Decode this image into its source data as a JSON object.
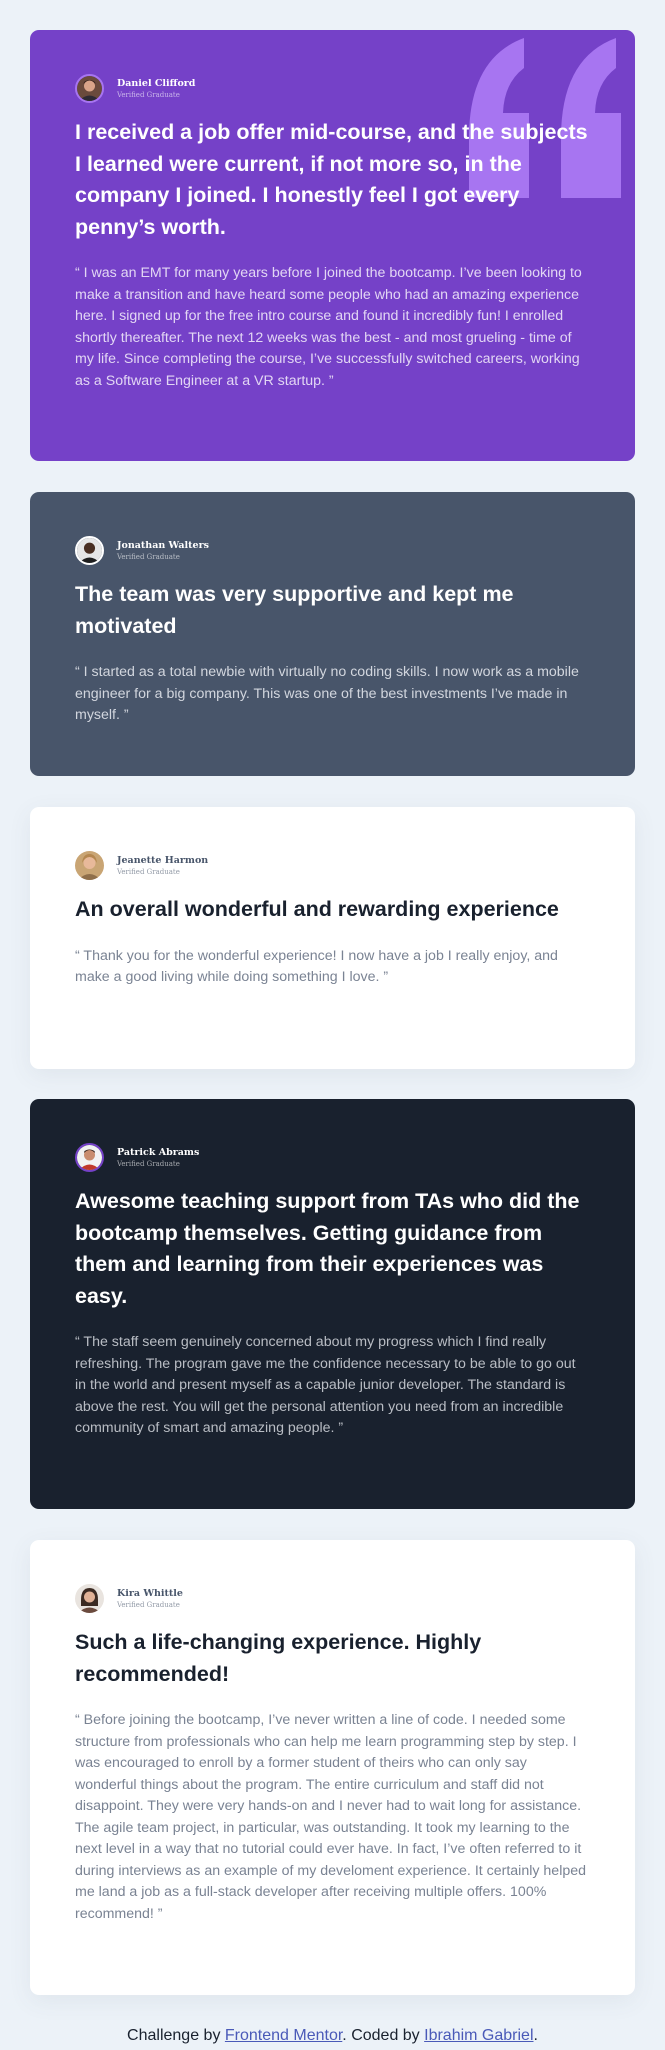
{
  "testimonials": [
    {
      "name": "Daniel Clifford",
      "role": "Verified Graduate",
      "headline": "I received a job offer mid-course, and the subjects I learned were current, if not more so, in the company I joined. I honestly feel I got every penny’s worth.",
      "body": "“ I was an EMT for many years before I joined the bootcamp. I’ve been looking to make a transition and have heard some people who had an amazing experience here. I signed up for the free intro course and found it incredibly fun! I enrolled shortly thereafter. The next 12 weeks was the best - and most grueling - time of my life. Since completing the course, I’ve successfully switched careers, working as a Software Engineer at a VR startup. ”"
    },
    {
      "name": "Jonathan Walters",
      "role": "Verified Graduate",
      "headline": "The team was very supportive and kept me motivated",
      "body": "“ I started as a total newbie with virtually no coding skills. I now work as a mobile engineer for a big company. This was one of the best investments I’ve made in myself. ”"
    },
    {
      "name": "Jeanette Harmon",
      "role": "Verified Graduate",
      "headline": "An overall wonderful and rewarding experience",
      "body": "“ Thank you for the wonderful experience! I now have a job I really enjoy, and make a good living while doing something I love. ”"
    },
    {
      "name": "Patrick Abrams",
      "role": "Verified Graduate",
      "headline": "Awesome teaching support from TAs who did the bootcamp themselves. Getting guidance from them and learning from their experiences was easy.",
      "body": "“ The staff seem genuinely concerned about my progress which I find really refreshing. The program gave me the confidence necessary to be able to go out in the world and present myself as a capable junior developer. The standard is above the rest. You will get the personal attention you need from an incredible community of smart and amazing people. ”"
    },
    {
      "name": "Kira Whittle",
      "role": "Verified Graduate",
      "headline": "Such a life-changing experience. Highly recommended!",
      "body": "“ Before joining the bootcamp, I’ve never written a line of code. I needed some structure from professionals who can help me learn programming step by step. I was encouraged to enroll by a former student of theirs who can only say wonderful things about the program. The entire curriculum and staff did not disappoint. They were very hands-on and I never had to wait long for assistance. The agile team project, in particular, was outstanding. It took my learning to the next level in a way that no tutorial could ever have. In fact, I’ve often referred to it during interviews as an example of my develoment experience. It certainly helped me land a job as a full-stack developer after receiving multiple offers. 100% recommend! ”"
    }
  ],
  "footer": {
    "prefix": "Challenge by ",
    "link1": "Frontend Mentor",
    "middle": ". Coded by ",
    "link2": "Ibrahim Gabriel",
    "suffix": "."
  },
  "colors": {
    "purple": "#7541c8",
    "slate": "#48556a",
    "white": "#ffffff",
    "dark": "#19212e",
    "background": "#ecf2f8",
    "quote_icon": "#a775f1"
  },
  "icons": {
    "quote": "quote-icon",
    "avatar": "avatar"
  }
}
